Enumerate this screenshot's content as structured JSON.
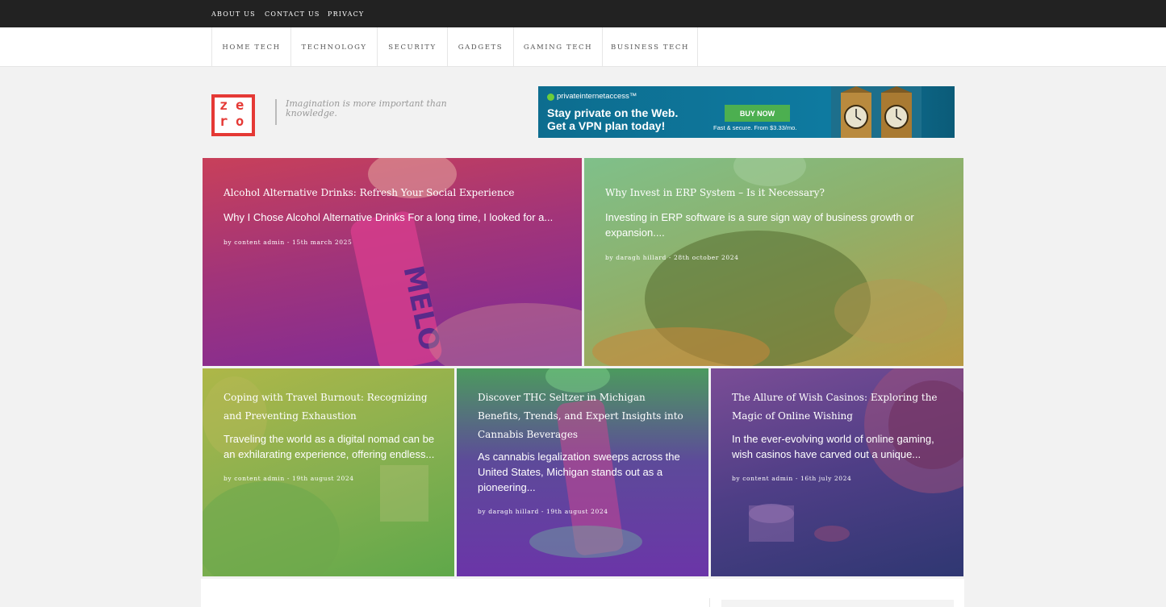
{
  "topbar": {
    "links": [
      "About Us",
      "Contact Us",
      "Privacy"
    ]
  },
  "nav": {
    "items": [
      "Home Tech",
      "Technology",
      "Security",
      "Gadgets",
      "Gaming Tech",
      "Business Tech"
    ]
  },
  "header": {
    "logo_letters": [
      "z",
      "e",
      "r",
      "o"
    ],
    "tagline": "Imagination is more important than knowledge."
  },
  "ad": {
    "brand": "privateinternetaccess™",
    "headline_1": "Stay private on the Web.",
    "headline_2": "Get a VPN plan today!",
    "button": "BUY NOW",
    "small_print": "Fast & secure. From $3.33/mo."
  },
  "posts": [
    {
      "title": "Alcohol Alternative Drinks: Refresh Your Social Experience",
      "excerpt": "Why I Chose Alcohol Alternative Drinks For a long time, I looked for a...",
      "meta": "by content admin - 15th march 2025"
    },
    {
      "title": "Why Invest in ERP System – Is it Necessary?",
      "excerpt": "Investing in ERP software is a sure sign way of business growth or expansion....",
      "meta": "by daragh hillard - 28th october 2024"
    },
    {
      "title": "Coping with Travel Burnout: Recognizing and Preventing Exhaustion",
      "excerpt": "Traveling the world as a digital nomad can be an exhilarating experience, offering endless...",
      "meta": "by content admin - 19th august 2024"
    },
    {
      "title": "Discover THC Seltzer in Michigan Benefits, Trends, and Expert Insights into Cannabis Beverages",
      "excerpt": "As cannabis legalization sweeps across the United States, Michigan stands out as a pioneering...",
      "meta": "by daragh hillard - 19th august 2024"
    },
    {
      "title": "The Allure of Wish Casinos: Exploring the Magic of Online Wishing",
      "excerpt": "In the ever-evolving world of online gaming, wish casinos have carved out a unique...",
      "meta": "by content admin - 16th july 2024"
    }
  ],
  "colors": {
    "topbar": "#222222",
    "logo_red": "#e53935",
    "ad_button": "#4caf50"
  }
}
